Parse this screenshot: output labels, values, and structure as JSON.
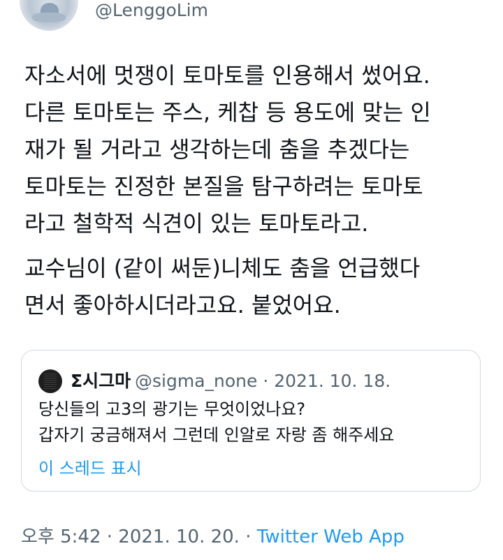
{
  "author": {
    "handle": "@LenggoLim"
  },
  "tweet": {
    "paragraph1": "자소서에 멋쟁이 토마토를 인용해서 썼어요.\n다른 토마토는 주스, 케찹 등 용도에 맞는 인\n재가 될 거라고 생각하는데 춤을 추겠다는\n토마토는 진정한 본질을 탐구하려는 토마토\n라고 철학적 식견이 있는 토마토라고.",
    "paragraph2": "교수님이 (같이 써둔)니체도 춤을 언급했다\n면서 좋아하시더라고요. 붙었어요."
  },
  "quote": {
    "name": "Σ시그마",
    "meta": "@sigma_none · 2021. 10. 18.",
    "body": "당신들의 고3의 광기는 무엇이었나요?\n갑자기 궁금해져서 그런데 인알로 자랑 좀 해주세요",
    "show_thread": "이 스레드 표시"
  },
  "footer": {
    "time_date": "오후 5:42 · 2021. 10. 20. · ",
    "app": "Twitter Web App"
  },
  "colors": {
    "text": "#0f1419",
    "secondary": "#536471",
    "link": "#1d9bf0",
    "border": "#cfd9de"
  }
}
